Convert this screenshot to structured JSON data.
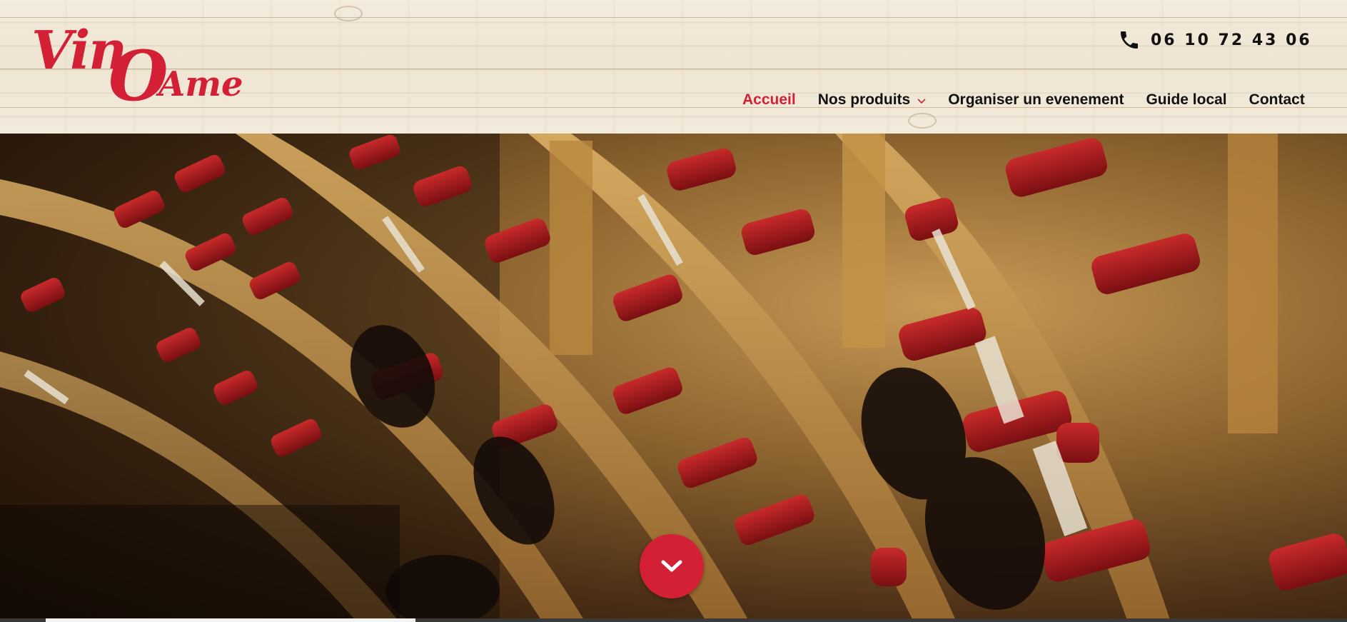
{
  "brand": {
    "logo_text": "VinOAme",
    "accent_color": "#d42035"
  },
  "header": {
    "phone_icon": "phone-icon",
    "phone_number": "06 10 72 43 06"
  },
  "nav": {
    "items": [
      {
        "label": "Accueil",
        "active": true
      },
      {
        "label": "Nos produits",
        "has_dropdown": true,
        "icon": "chevron-down-icon"
      },
      {
        "label": "Organiser un evenement"
      },
      {
        "label": "Guide local"
      },
      {
        "label": "Contact"
      }
    ]
  },
  "hero": {
    "scroll_icon": "chevron-down-icon"
  }
}
